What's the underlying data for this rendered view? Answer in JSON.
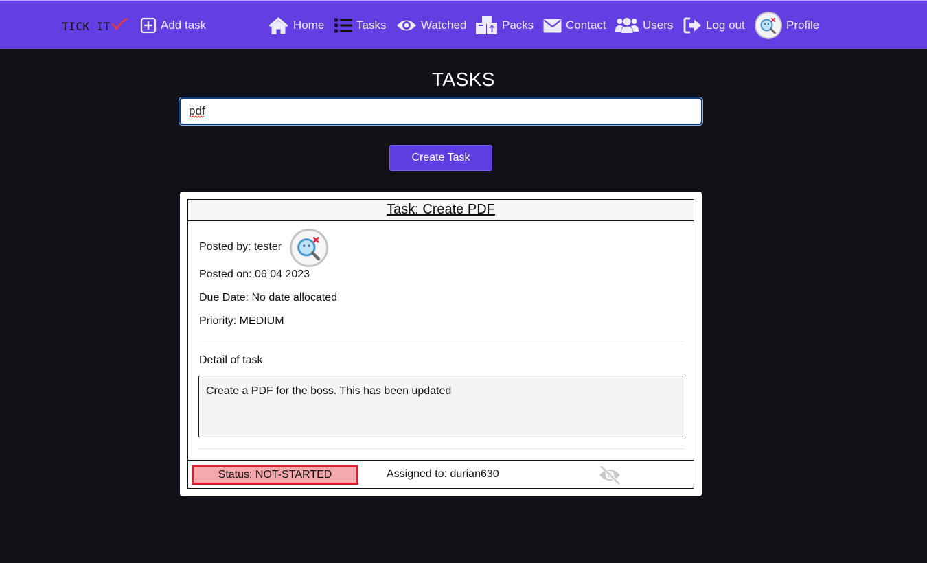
{
  "nav": {
    "brand": "TICK IT",
    "add_task": "Add task",
    "home": "Home",
    "tasks": "Tasks",
    "watched": "Watched",
    "packs": "Packs",
    "contact": "Contact",
    "users": "Users",
    "logout": "Log out",
    "profile": "Profile"
  },
  "page": {
    "title": "TASKS",
    "search_value": "pdf",
    "create_button": "Create Task"
  },
  "task": {
    "title": "Task: Create PDF",
    "posted_by": "Posted by: tester",
    "posted_on": "Posted on: 06 04 2023",
    "due_date": "Due Date: No date allocated",
    "priority": "Priority: MEDIUM",
    "detail_label": "Detail of task",
    "detail": "Create a PDF for the boss. This has been updated",
    "status": "Status: NOT-STARTED",
    "assigned": "Assigned to: durian630"
  },
  "icons": {
    "add": "plus-square-icon",
    "home": "house-icon",
    "tasks": "list-icon",
    "watched": "eye-icon",
    "packs": "boxes-icon",
    "contact": "envelope-icon",
    "users": "users-icon",
    "logout": "sign-out-icon",
    "avatar": "magnifier-avatar-icon",
    "watch_toggle": "eye-slash-icon",
    "brand_check": "checkmark-icon"
  },
  "colors": {
    "navbar": "#633ee3",
    "background": "#121017",
    "button": "#5d3ee0",
    "status_fill": "#f6a9ad",
    "status_border": "#e01a2a",
    "brand_check": "#e8393c"
  }
}
